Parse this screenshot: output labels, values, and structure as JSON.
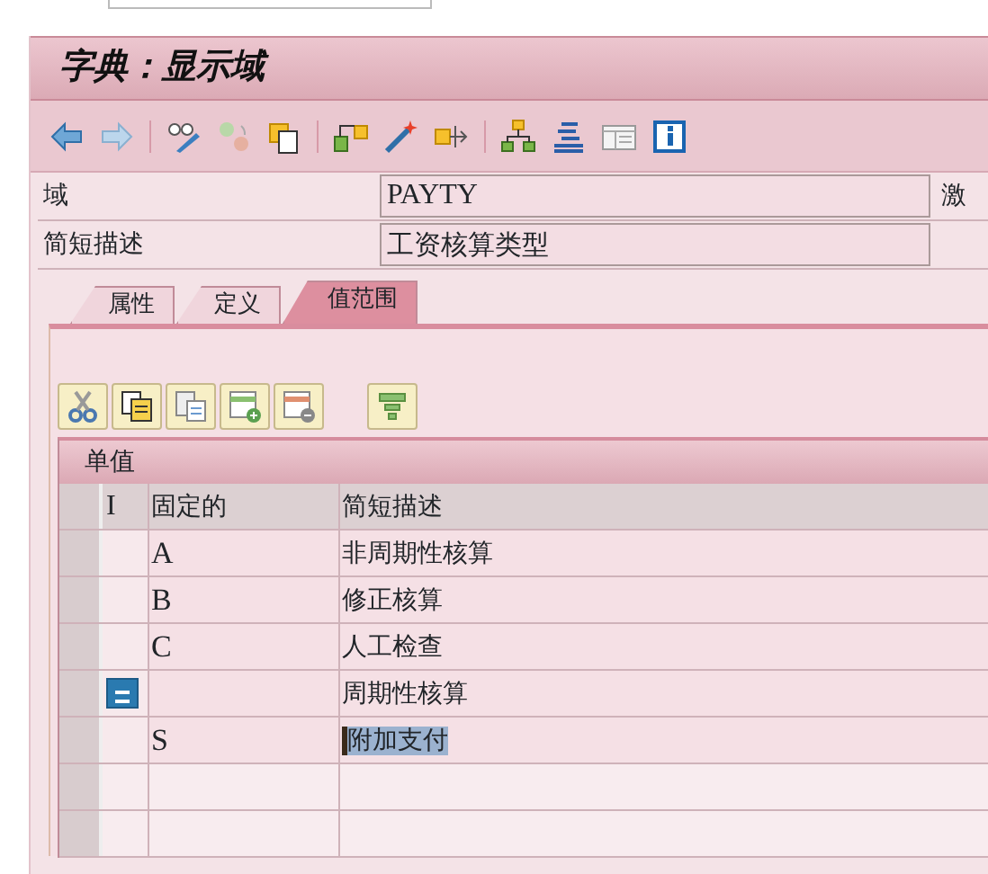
{
  "window": {
    "title": "字典：显示域"
  },
  "fields": [
    {
      "label": "域",
      "value": "PAYTY",
      "trailing": "激"
    },
    {
      "label": "简短描述",
      "value": "工资核算类型"
    }
  ],
  "tabs": [
    {
      "label": "属性",
      "selected": false
    },
    {
      "label": "定义",
      "selected": false
    },
    {
      "label": "值范围",
      "selected": true
    }
  ],
  "table": {
    "title": "单值",
    "columns": [
      "I",
      "固定的",
      "简短描述"
    ],
    "rows": [
      {
        "indicator": false,
        "fixed": "A",
        "description": "非周期性核算",
        "selected": false
      },
      {
        "indicator": false,
        "fixed": "B",
        "description": "修正核算",
        "selected": false
      },
      {
        "indicator": false,
        "fixed": "C",
        "description": "人工检查",
        "selected": false
      },
      {
        "indicator": true,
        "fixed": "",
        "description": "周期性核算",
        "selected": false
      },
      {
        "indicator": false,
        "fixed": "S",
        "description": "附加支付",
        "selected": true
      }
    ]
  }
}
